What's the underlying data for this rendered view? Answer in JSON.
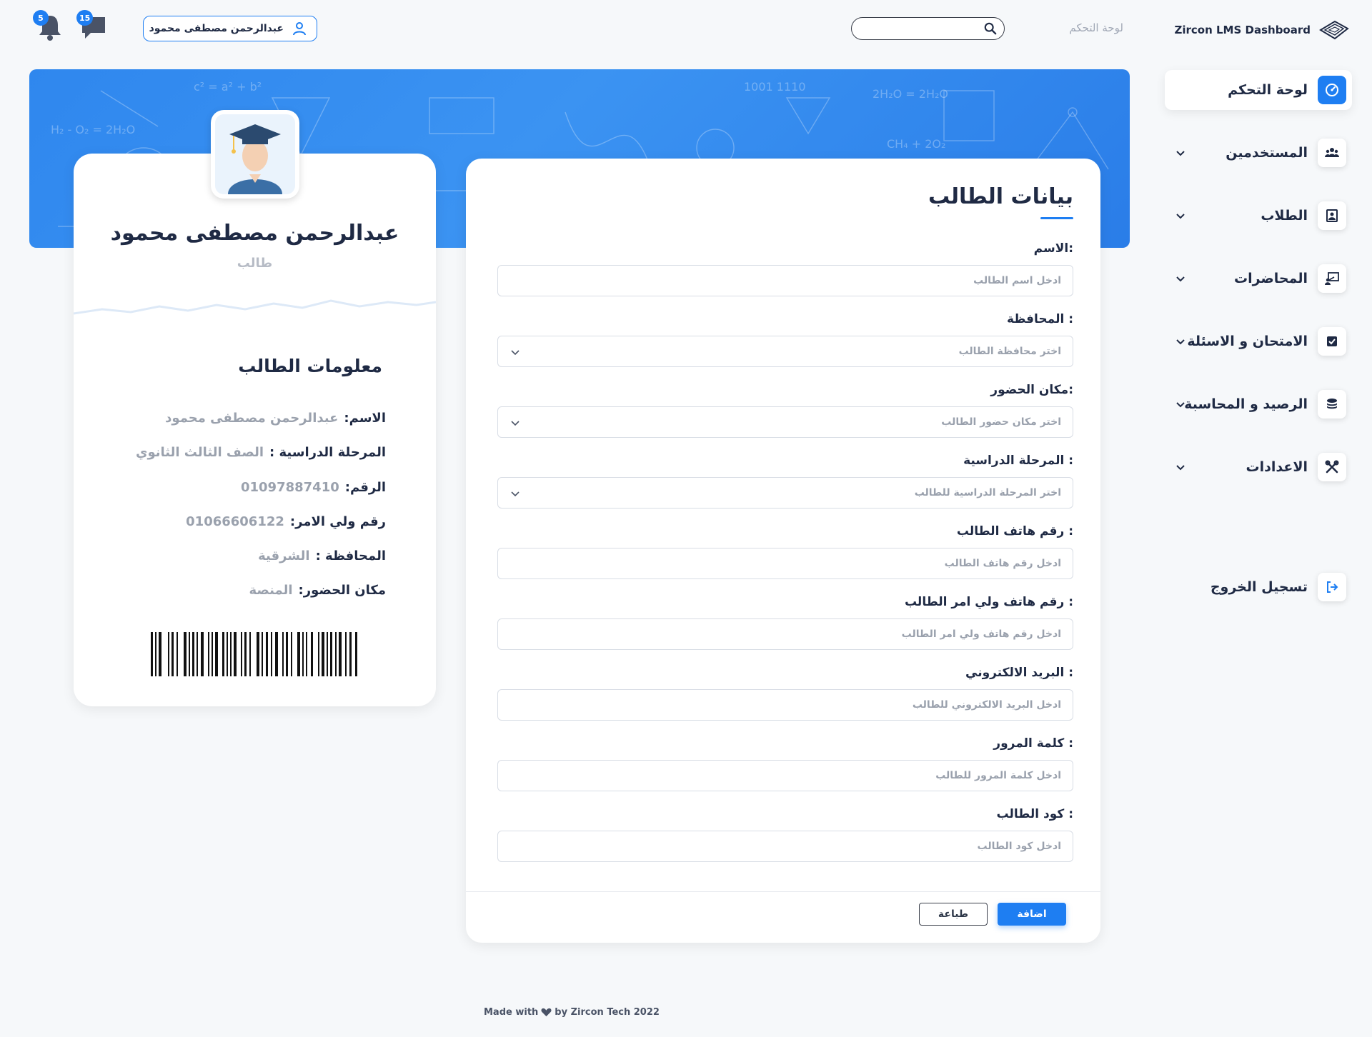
{
  "app": {
    "brand_name": "Zircon LMS Dashboard",
    "breadcrumb": "لوحة التحكم",
    "accent_color": "#1e7ef2"
  },
  "topbar": {
    "search_value": "",
    "user_name": "عبدالرحمن مصطفى محمود",
    "messages_count": "15",
    "notifications_count": "5"
  },
  "sidebar": {
    "items": [
      {
        "label": "لوحة التحكم",
        "icon": "dashboard-icon",
        "active": true
      },
      {
        "label": "المستخدمين",
        "icon": "users-icon"
      },
      {
        "label": "الطلاب",
        "icon": "student-icon"
      },
      {
        "label": "المحاضرات",
        "icon": "lecture-icon"
      },
      {
        "label": "الامتحان و الاسئلة",
        "icon": "exam-icon"
      },
      {
        "label": "الرصيد و المحاسبة",
        "icon": "coins-icon"
      },
      {
        "label": "الاعدادات",
        "icon": "settings-tools-icon"
      }
    ],
    "logout_label": "تسجيل الخروج"
  },
  "form": {
    "title": "بيانات الطالب",
    "fields": [
      {
        "label": "الاسم:",
        "placeholder": "ادخل اسم الطالب",
        "type": "text"
      },
      {
        "label": "المحافظة :",
        "placeholder": "اختر محافظة الطالب",
        "type": "select"
      },
      {
        "label": "مكان الحضور:",
        "placeholder": "اختر مكان حضور الطالب",
        "type": "select"
      },
      {
        "label": "المرحلة الدراسية :",
        "placeholder": "اختر المرحلة الدراسية للطالب",
        "type": "select"
      },
      {
        "label": "رقم هاتف الطالب :",
        "placeholder": "ادخل رقم هاتف الطالب",
        "type": "text"
      },
      {
        "label": "رقم هاتف ولي امر الطالب :",
        "placeholder": "ادخل رقم هاتف ولي امر الطالب",
        "type": "text"
      },
      {
        "label": "البريد الالكتروني :",
        "placeholder": "ادخل البريد الالكتروني للطالب",
        "type": "text"
      },
      {
        "label": "كلمة المرور :",
        "placeholder": "ادخل كلمة المرور للطالب",
        "type": "text"
      },
      {
        "label": "كود الطالب :",
        "placeholder": "ادخل كود الطالب",
        "type": "text"
      }
    ],
    "add_label": "اضافة",
    "print_label": "طباعة"
  },
  "profile": {
    "name": "عبدالرحمن مصطفى محمود",
    "role": "طالب",
    "info_title": "معلومات الطالب",
    "rows": [
      {
        "key": "الاسم:",
        "value": "عبدالرحمن مصطفى محمود"
      },
      {
        "key": "المرحلة الدراسية :",
        "value": "الصف الثالث الثانوي"
      },
      {
        "key": "الرقم:",
        "value": "01097887410"
      },
      {
        "key": "رقم ولي الامر:",
        "value": "01066606122"
      },
      {
        "key": "المحافظة :",
        "value": "الشرقية"
      },
      {
        "key": "مكان الحضور:",
        "value": "المنصة"
      }
    ]
  },
  "footer": {
    "made_with": "Made with",
    "by_text": "by Zircon Tech 2022"
  }
}
